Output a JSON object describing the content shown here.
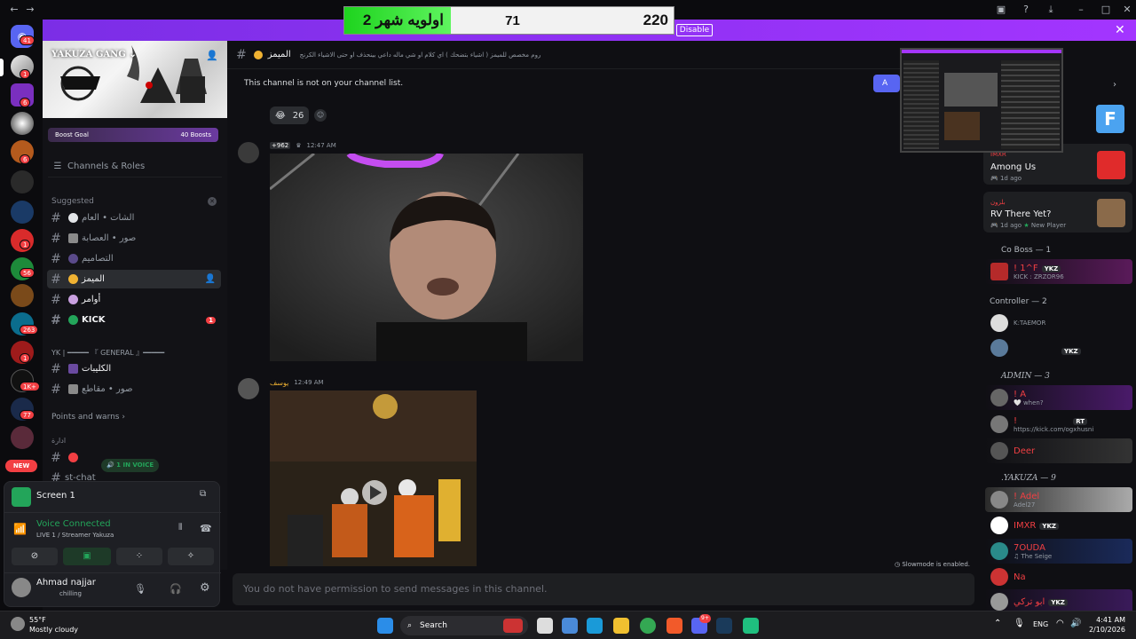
{
  "overlay": {
    "team_name": "اولويه شهر 2",
    "mid_score": "71",
    "right_score": "220",
    "disable_label": "Disable"
  },
  "server": {
    "name": "YAKUZA GANG",
    "boost_goal": "Boost Goal",
    "boosts": "40 Boosts",
    "channels_roles": "Channels & Roles"
  },
  "sidebar": {
    "suggested": "Suggested",
    "channels": [
      {
        "name": "الشات • العام"
      },
      {
        "name": "صور • العصابة"
      },
      {
        "name": "التصاميم"
      },
      {
        "name": "الميمز"
      },
      {
        "name": "أوامر"
      },
      {
        "name": "KICK"
      }
    ],
    "kick_badge": "1",
    "category_general": "YK | ━━━━━ 『 GENERAL 』━━━━━",
    "general_channels": [
      {
        "name": "الكليبات"
      },
      {
        "name": "صور • مقاطع"
      }
    ],
    "points_warns": "Points and warns",
    "category_admin": "ادارة",
    "in_voice": "1 IN VOICE",
    "bottom_chat": "st-chat"
  },
  "server_badges": [
    "41",
    "1",
    "6",
    "6",
    "1",
    "56",
    "263",
    "1",
    "1K+",
    "77"
  ],
  "new_label": "NEW",
  "screen_share": {
    "title": "Screen 1"
  },
  "voice": {
    "status": "Voice Connected",
    "channel": "LIVE 1 / Streamer Yakuza"
  },
  "user": {
    "name": "Ahmad najjar",
    "status": "chilling"
  },
  "channel_header": {
    "name": "الميمز",
    "topic": "روم مخصص للميمز ( اشياء بتضحك ) اي كلام او شي ماله داعي بينحذف او حتى الاشياء الكرنج"
  },
  "notice": {
    "text": "This channel is not on your channel list.",
    "button": "A"
  },
  "messages": [
    {
      "reaction_emoji": "😂",
      "reaction_count": "26"
    },
    {
      "tag": "+962",
      "time": "12:47 AM"
    },
    {
      "author": "يوسف",
      "time": "12:49 AM"
    }
  ],
  "slowmode": "Slowmode is enabled.",
  "input_placeholder": "You do not have permission to send messages in this channel.",
  "activities": [
    {
      "title": "Among Us",
      "time": "1d ago",
      "user": "IMXR"
    },
    {
      "title": "RV There Yet?",
      "time": "1d ago",
      "extra": "New Player",
      "user": "بلزون"
    }
  ],
  "members": {
    "coboss": {
      "header": "Co Boss — 1",
      "rows": [
        {
          "name": "! 1^F",
          "tag": "YKZ",
          "sub": "KICK : ZRZOR96"
        }
      ]
    },
    "controller": {
      "header": "Controller — 2",
      "rows": [
        {
          "name": "",
          "sub": "K:TAEMOR"
        },
        {
          "name": "",
          "tag": "YKZ",
          "sub": ""
        }
      ]
    },
    "admin": {
      "header": "ADMIN — 3",
      "rows": [
        {
          "name": "! A",
          "sub": "when?"
        },
        {
          "name": "! ",
          "tag": "RT",
          "sub": "https://kick.com/ogxhusni"
        },
        {
          "name": "Deer",
          "sub": ""
        }
      ]
    },
    "yakuza": {
      "header": ".YAKUZA — 9",
      "rows": [
        {
          "name": "! Adel",
          "sub": "Adel27"
        },
        {
          "name": "IMXR",
          "tag": "YKZ",
          "sub": ""
        },
        {
          "name": "7OUDA",
          "sub": "The Seige"
        },
        {
          "name": "Na",
          "sub": ""
        },
        {
          "name": "ابو تركي",
          "tag": "YKZ",
          "sub": ""
        }
      ]
    }
  },
  "taskbar": {
    "weather_temp": "55°F",
    "weather_desc": "Mostly cloudy",
    "search": "Search",
    "lang": "ENG",
    "time": "4:41 AM",
    "date": "2/10/2026",
    "discord_badge": "9+"
  },
  "colors": {
    "accent": "#a335ff",
    "danger": "#f23f43",
    "voice_green": "#23a55a",
    "blurple": "#5865f2"
  }
}
